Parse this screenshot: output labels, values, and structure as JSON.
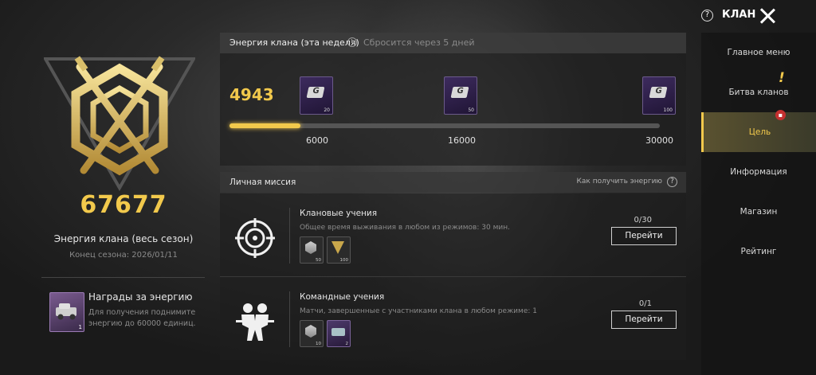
{
  "header": {
    "title": "КЛАН",
    "help_icon": "question-icon",
    "close_icon": "close-icon"
  },
  "left": {
    "total_energy": "67677",
    "season_label": "Энергия клана (весь сезон)",
    "season_end": "Конец сезона: 2026/01/11",
    "reward": {
      "title": "Награды за энергию",
      "desc": "Для получения поднимите энергию до 60000 единиц.",
      "count": "1"
    }
  },
  "weekly": {
    "title": "Энергия клана (эта неделя)",
    "reset": "Сбросится через 5 дней",
    "value": "4943",
    "progress_fraction": 0.165,
    "milestones": [
      {
        "label": "6000",
        "count": "20"
      },
      {
        "label": "16000",
        "count": "50"
      },
      {
        "label": "30000",
        "count": "100"
      }
    ]
  },
  "missions": {
    "title": "Личная миссия",
    "how": "Как получить энергию",
    "items": [
      {
        "title": "Клановые учения",
        "desc": "Общее время выживания в любом из режимов: 30 мин.",
        "progress": "0/30",
        "button": "Перейти",
        "rewards": [
          {
            "count": "50"
          },
          {
            "count": "100"
          }
        ]
      },
      {
        "title": "Командные учения",
        "desc": "Матчи, завершенные с участниками клана в любом режиме: 1",
        "progress": "0/1",
        "button": "Перейти",
        "rewards": [
          {
            "count": "10"
          },
          {
            "count": "2"
          }
        ]
      }
    ]
  },
  "nav": {
    "items": [
      {
        "label": "Главное меню"
      },
      {
        "label": "Битва кланов"
      },
      {
        "label": "Цель"
      },
      {
        "label": "Информация"
      },
      {
        "label": "Магазин"
      },
      {
        "label": "Рейтинг"
      }
    ],
    "active_index": 2
  },
  "colors": {
    "accent": "#f2c94c",
    "panel": "#1e1e1e",
    "reward_purple": "#3d2b5e"
  }
}
